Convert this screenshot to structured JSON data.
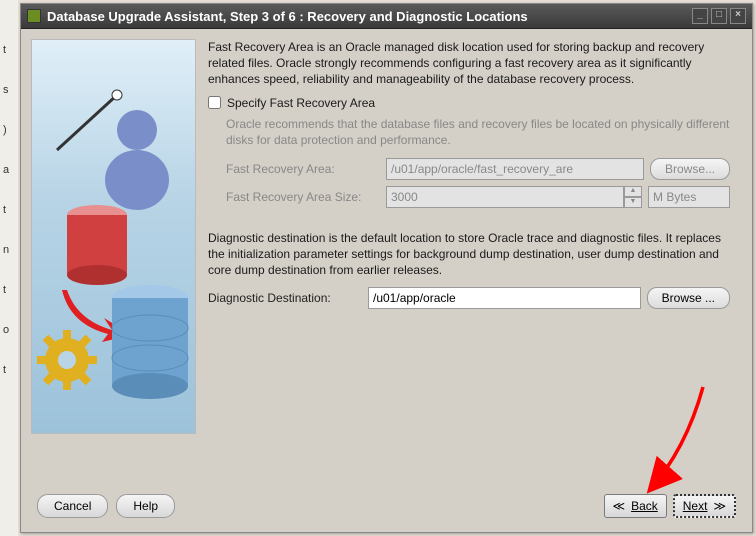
{
  "window": {
    "title": "Database Upgrade Assistant, Step 3 of 6 : Recovery and Diagnostic Locations",
    "min": "_",
    "max": "□",
    "close": "×"
  },
  "intro": "Fast Recovery Area is an Oracle managed disk location used for storing backup and recovery related files.  Oracle strongly recommends configuring a fast recovery area as it significantly enhances speed, reliability and manageability of the database recovery process.",
  "specify_label": "Specify Fast Recovery Area",
  "recommend": "Oracle recommends that the database files and recovery files be located on physically different disks for data protection and performance.",
  "fra": {
    "path_label": "Fast Recovery Area:",
    "path_value": "/u01/app/oracle/fast_recovery_are",
    "browse": "Browse...",
    "size_label": "Fast Recovery Area Size:",
    "size_value": "3000",
    "unit": "M Bytes"
  },
  "diag": {
    "intro": "Diagnostic destination is the default location to store Oracle trace and diagnostic files.  It replaces the initialization parameter settings for background dump destination, user dump destination and core dump destination from earlier releases.",
    "label": "Diagnostic Destination:",
    "value": "/u01/app/oracle",
    "browse": "Browse ..."
  },
  "footer": {
    "cancel": "Cancel",
    "help": "Help",
    "back": "Back",
    "next": "Next"
  }
}
